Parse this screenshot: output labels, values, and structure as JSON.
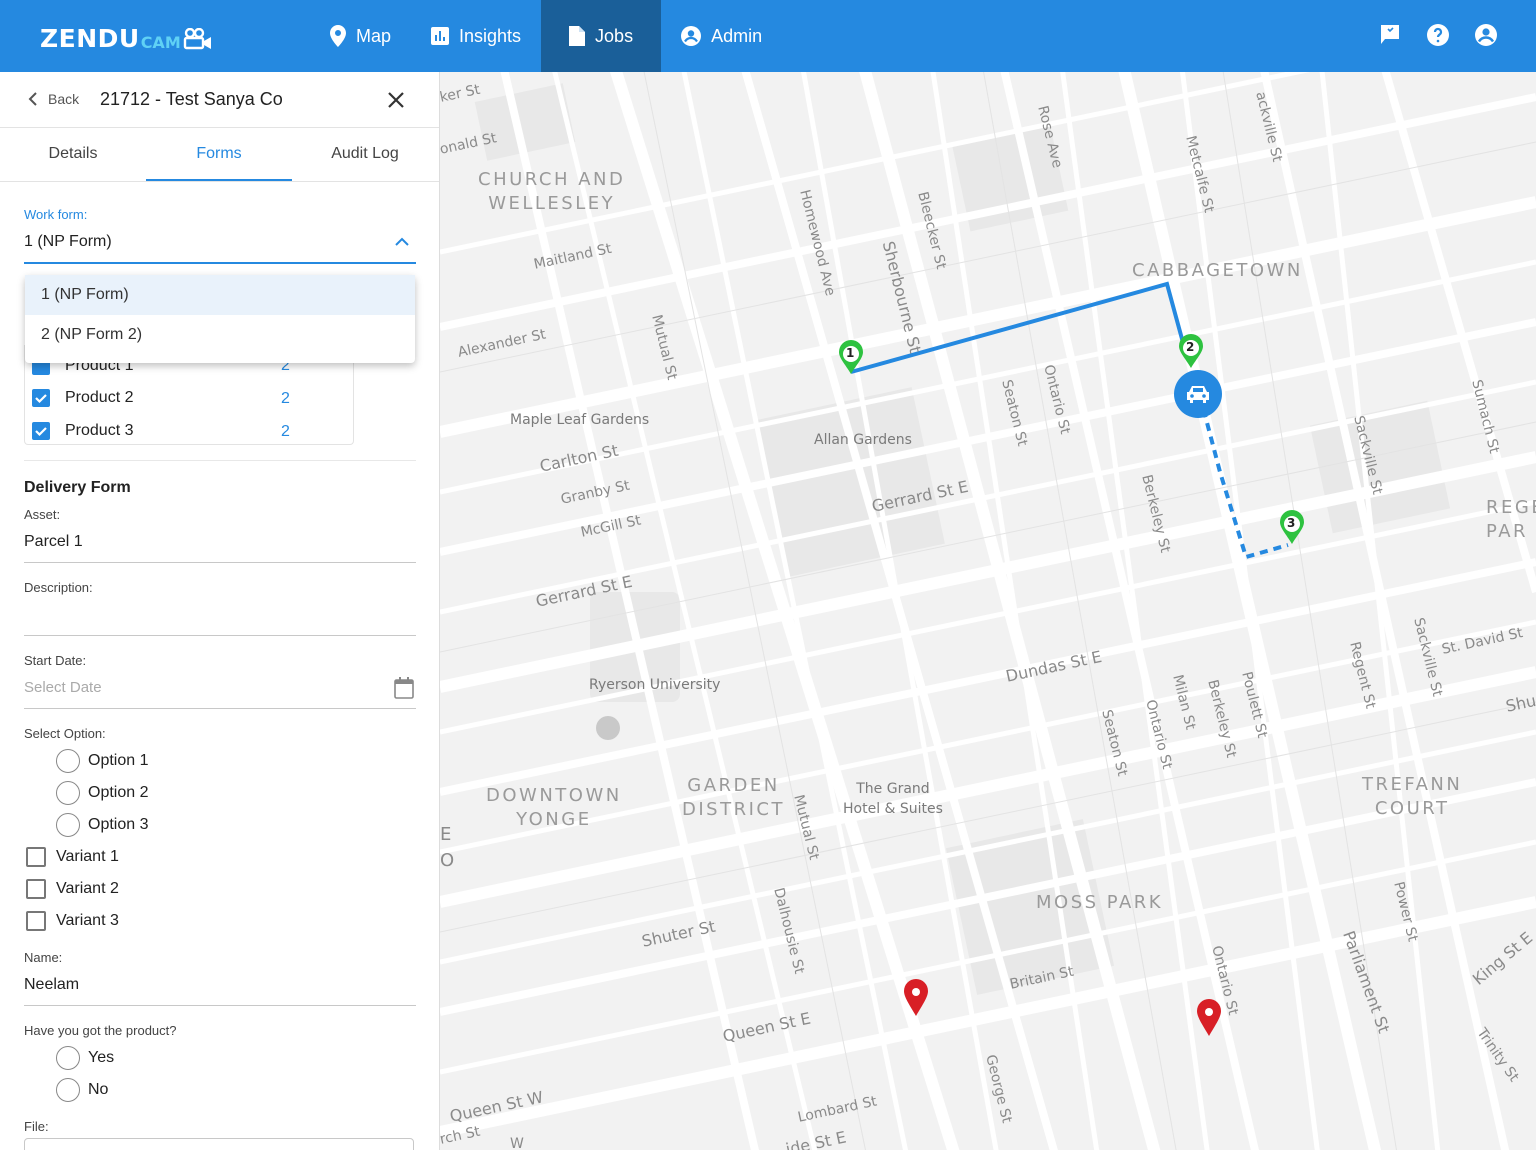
{
  "app": {
    "logo_main": "ZENDU",
    "logo_sub": "CAM",
    "nav": [
      {
        "label": "Map",
        "icon": "pin-icon"
      },
      {
        "label": "Insights",
        "icon": "chart-icon"
      },
      {
        "label": "Jobs",
        "icon": "document-icon",
        "active": true
      },
      {
        "label": "Admin",
        "icon": "account-icon"
      }
    ],
    "accent_color": "#2589e0",
    "active_nav_color": "#1a5f99"
  },
  "panel": {
    "back_label": "Back",
    "job_title": "21712 - Test Sanya Co",
    "tabs": [
      "Details",
      "Forms",
      "Audit Log"
    ],
    "active_tab": "Forms",
    "work_form_label": "Work form:",
    "work_form_value": "1 (NP Form)",
    "work_form_options": [
      "1 (NP Form)",
      "2 (NP Form 2)"
    ],
    "products": [
      {
        "name": "Product 1",
        "qty": "2",
        "checked": true
      },
      {
        "name": "Product 2",
        "qty": "2",
        "checked": true
      },
      {
        "name": "Product 3",
        "qty": "2",
        "checked": true
      }
    ],
    "delivery": {
      "title": "Delivery Form",
      "asset_label": "Asset:",
      "asset_value": "Parcel 1",
      "description_label": "Description:",
      "description_value": "",
      "start_date_label": "Start Date:",
      "start_date_placeholder": "Select Date",
      "select_option_label": "Select Option:",
      "options": [
        "Option 1",
        "Option 2",
        "Option 3"
      ],
      "variants": [
        "Variant 1",
        "Variant 2",
        "Variant 3"
      ],
      "name_label": "Name:",
      "name_value": "Neelam",
      "question_label": "Have you got the product?",
      "answers": [
        "Yes",
        "No"
      ],
      "file_label": "File:"
    }
  },
  "map": {
    "neighbourhoods": [
      "CHURCH AND\nWELLESLEY",
      "CABBAGETOWN",
      "DOWNTOWN\nYONGE",
      "GARDEN\nDISTRICT",
      "MOSS PARK",
      "TREFANN\nCOURT",
      "REGE\nPAR"
    ],
    "pois": [
      "Maple Leaf Gardens",
      "Allan Gardens",
      "Ryerson University",
      "The Grand\nHotel & Suites"
    ],
    "streets": [
      "ker St",
      "onald St",
      "Maitland St",
      "Alexander St",
      "Carlton St",
      "Granby St",
      "McGill St",
      "Gerrard St E",
      "Gerrard St E",
      "Dundas St E",
      "Shuter St",
      "Queen St E",
      "Queen St W",
      "Lombard St",
      "Britain St",
      "King St E",
      "Trinity St",
      "St. David St",
      "Shu",
      "ide St E",
      "Homewood Ave",
      "Sherbourne St",
      "Bleecker St",
      "Rose Ave",
      "Metcalfe St",
      "ackville St",
      "Mutual St",
      "Seaton St",
      "Ontario St",
      "Berkeley St",
      "Sackville St",
      "Sumach St",
      "Milan St",
      "Berkeley St",
      "Poulett St",
      "Seaton St",
      "Ontario St",
      "Regent St",
      "Sackville St",
      "Mutual St",
      "Dalhousie St",
      "George St",
      "Ontario St",
      "Power St",
      "Parliament St",
      "rch St",
      "E",
      "O",
      "W"
    ],
    "stops": [
      "1",
      "2",
      "3"
    ],
    "route_color": "#2589e0",
    "stop_color": "#2ec240",
    "alert_color": "#d81f26"
  }
}
